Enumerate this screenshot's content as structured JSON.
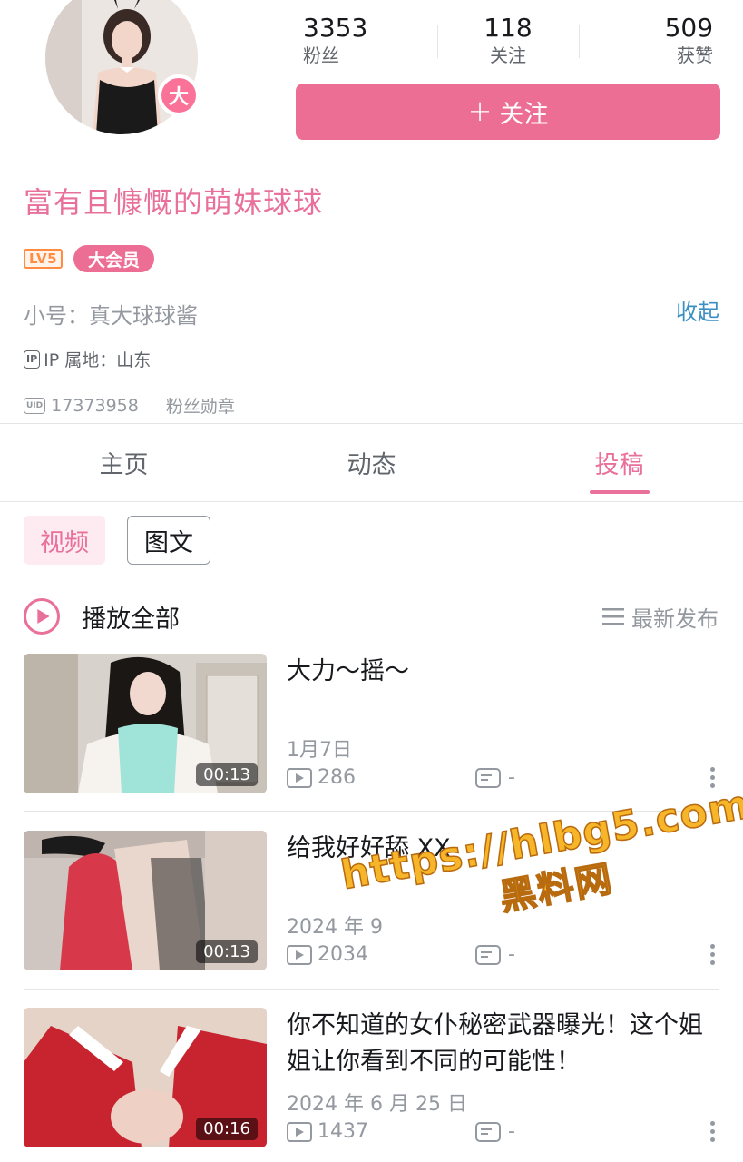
{
  "profile": {
    "vip_char": "大",
    "stats": [
      {
        "value": "3353",
        "label": "粉丝"
      },
      {
        "value": "118",
        "label": "关注"
      },
      {
        "value": "509",
        "label": "获赞"
      }
    ],
    "follow_plus": "+",
    "follow_label": "关注",
    "nickname": "富有且慷慨的萌妹球球",
    "level_badge": "LV5",
    "member_badge": "大会员",
    "sub_account": "小号：真大球球酱",
    "collapse": "收起",
    "ip_icon": "IP",
    "ip_location": "IP 属地：山东",
    "uid_icon": "UID",
    "uid": "17373958",
    "fan_medal": "粉丝勋章"
  },
  "tabs": [
    {
      "label": "主页"
    },
    {
      "label": "动态"
    },
    {
      "label": "投稿",
      "active": true
    }
  ],
  "filters": [
    {
      "label": "视频",
      "active": true
    },
    {
      "label": "图文",
      "active": false
    }
  ],
  "list_header": {
    "play_all": "播放全部",
    "sort": "最新发布"
  },
  "videos": [
    {
      "title": "大力～摇～",
      "duration": "00:13",
      "date": "1月7日",
      "plays": "286",
      "danmaku": "-"
    },
    {
      "title": "给我好好舔 XX",
      "duration": "00:13",
      "date": "2024 年 9",
      "plays": "2034",
      "danmaku": "-"
    },
    {
      "title": "你不知道的女仆秘密武器曝光！这个姐姐让你看到不同的可能性！",
      "duration": "00:16",
      "date": "2024 年 6 月 25 日",
      "plays": "1437",
      "danmaku": "-"
    }
  ],
  "watermark": {
    "url": "https://hlbg5.com",
    "label": "黑料网"
  },
  "colors": {
    "brand_pink": "#ed6e94",
    "text_pink": "#e8709a",
    "link_blue": "#3b8fc4",
    "level_orange": "#ff8c42",
    "watermark_gold": "#f7b529"
  }
}
